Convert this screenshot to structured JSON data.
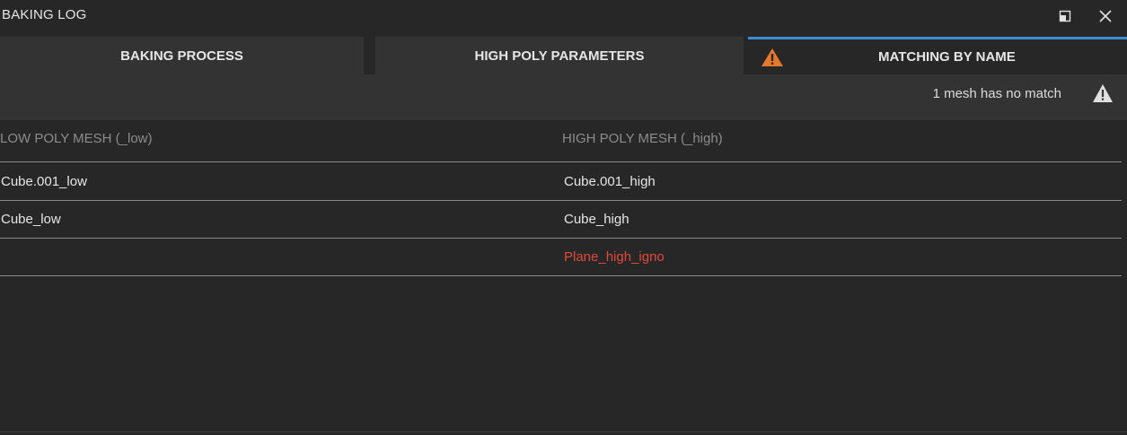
{
  "window": {
    "title": "BAKING LOG",
    "restore_icon": "restore-window-icon",
    "close_icon": "close-icon"
  },
  "tabs": [
    {
      "label": "BAKING PROCESS",
      "active": false
    },
    {
      "label": "HIGH POLY PARAMETERS",
      "active": false
    },
    {
      "label": "MATCHING BY NAME",
      "active": true,
      "icon": "warning-icon",
      "icon_color": "#e5782a"
    }
  ],
  "status": {
    "message": "1 mesh has no match",
    "icon": "warning-icon",
    "icon_color": "#e0e0e0"
  },
  "table": {
    "columns": [
      "LOW POLY MESH (_low)",
      "HIGH POLY MESH (_high)"
    ],
    "rows": [
      {
        "low": "Cube.001_low",
        "high": "Cube.001_high",
        "unmatched": false
      },
      {
        "low": "Cube_low",
        "high": "Cube_high",
        "unmatched": false
      },
      {
        "low": "",
        "high": "Plane_high_igno",
        "unmatched": true
      }
    ]
  },
  "colors": {
    "background": "#272727",
    "panel": "#333333",
    "accent": "#3b8bd6",
    "warning": "#e5782a",
    "error_text": "#e2483b"
  }
}
